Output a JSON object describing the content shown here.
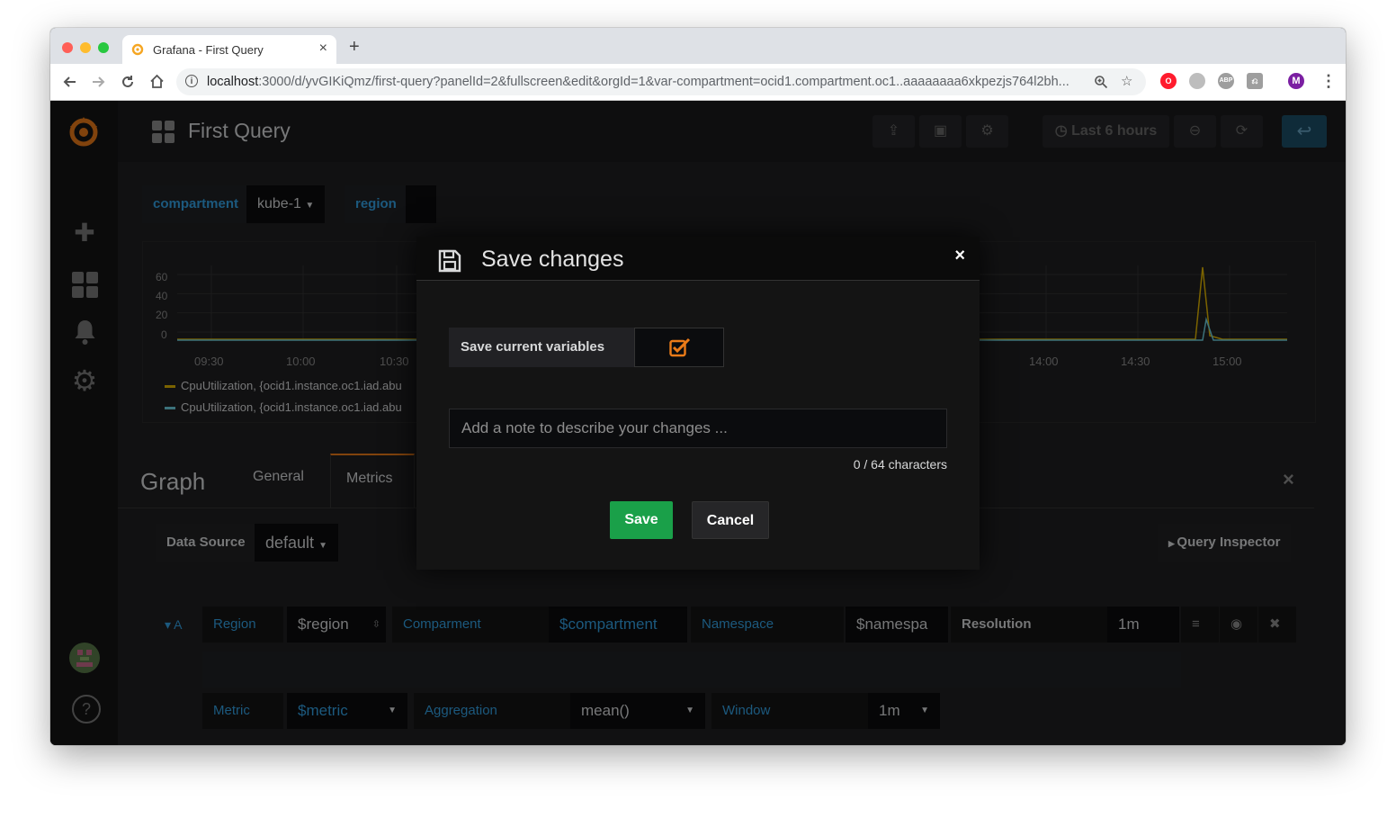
{
  "browser": {
    "tab_title": "Grafana - First Query",
    "tab_close": "×",
    "new_tab": "+",
    "url_host": "localhost",
    "url_rest": ":3000/d/yvGIKiQmz/first-query?panelId=2&fullscreen&edit&orgId=1&var-compartment=ocid1.compartment.oc1..aaaaaaaa6xkpezjs764l2bh...",
    "profile_initial": "M",
    "ext_abp": "ABP",
    "ext_last": "⎌",
    "colors": {
      "close": "#ff5f57",
      "minimize": "#febc2e",
      "maximize": "#28c840",
      "profile": "#7b1fa2"
    }
  },
  "grafana": {
    "dashboard_title": "First Query",
    "time_range": "Last 6 hours",
    "variables": [
      {
        "label": "compartment",
        "value": "kube-1"
      },
      {
        "label": "region",
        "value": ""
      }
    ],
    "chart_data": {
      "type": "line",
      "y_ticks": [
        "60",
        "40",
        "20",
        "0"
      ],
      "x_ticks": [
        "09:30",
        "10:00",
        "10:30",
        "14:00",
        "14:30",
        "15:00"
      ],
      "ylim": [
        0,
        60
      ],
      "series": [
        {
          "name": "CpuUtilization, {ocid1.instance.oc1.iad.abu",
          "color": "#e0b400"
        },
        {
          "name": "CpuUtilization, {ocid1.instance.oc1.iad.abu",
          "color": "#6ed0e0"
        }
      ]
    },
    "editor": {
      "title": "Graph",
      "tabs": [
        "General",
        "Metrics"
      ],
      "close": "×",
      "data_source_label": "Data Source",
      "data_source_value": "default",
      "query_inspector": "Query Inspector",
      "query_ref": "A",
      "row1": [
        {
          "label": "Region",
          "value": "$region"
        },
        {
          "label": "Comparment",
          "value": "$compartment"
        },
        {
          "label": "Namespace",
          "value": "$namespa"
        },
        {
          "label": "Resolution",
          "value": "1m"
        }
      ],
      "row2": [
        {
          "label": "Metric",
          "value": "$metric"
        },
        {
          "label": "Aggregation",
          "value": "mean()"
        },
        {
          "label": "Window",
          "value": "1m"
        }
      ]
    },
    "help": "?"
  },
  "modal": {
    "title": "Save changes",
    "close": "×",
    "save_variables_label": "Save current variables",
    "save_variables_checked": true,
    "note_placeholder": "Add a note to describe your changes ...",
    "note_value": "",
    "char_count": "0 / 64 characters",
    "save_label": "Save",
    "cancel_label": "Cancel",
    "colors": {
      "save": "#1aa049",
      "checkbox": "#eb7b18"
    }
  }
}
